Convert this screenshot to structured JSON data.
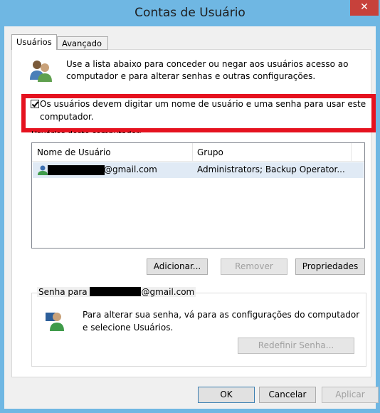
{
  "window": {
    "title": "Contas de Usuário",
    "close_glyph": "✕"
  },
  "tabs": [
    {
      "label": "Usuários",
      "active": true
    },
    {
      "label": "Avançado",
      "active": false
    }
  ],
  "intro": {
    "text": "Use a lista abaixo para conceder ou negar aos usuários acesso ao computador e para alterar senhas e outras configurações."
  },
  "checkbox": {
    "checked": true,
    "label": "Os usuários devem digitar um nome de usuário e uma senha para usar este computador."
  },
  "users_group": {
    "caption": "Usuários deste computador:"
  },
  "user_list": {
    "columns": [
      "Nome de Usuário",
      "Grupo"
    ],
    "rows": [
      {
        "name_suffix": "@gmail.com",
        "group": "Administrators; Backup Operator..."
      }
    ]
  },
  "buttons": {
    "add": "Adicionar...",
    "remove": "Remover",
    "properties": "Propriedades",
    "reset_password": "Redefinir Senha...",
    "ok": "OK",
    "cancel": "Cancelar",
    "apply": "Aplicar"
  },
  "password_group": {
    "caption_prefix": "Senha para",
    "caption_suffix": "@gmail.com",
    "text": "Para alterar sua senha, vá para as configurações do computador e selecione Usuários."
  },
  "colors": {
    "titlebar": "#6fb7e3",
    "close_button": "#c7413b",
    "highlight_box": "#e5121f",
    "selected_row": "#e0eaf5"
  },
  "icons": [
    "users-icon",
    "user-icon",
    "password-user-icon",
    "close-icon"
  ]
}
